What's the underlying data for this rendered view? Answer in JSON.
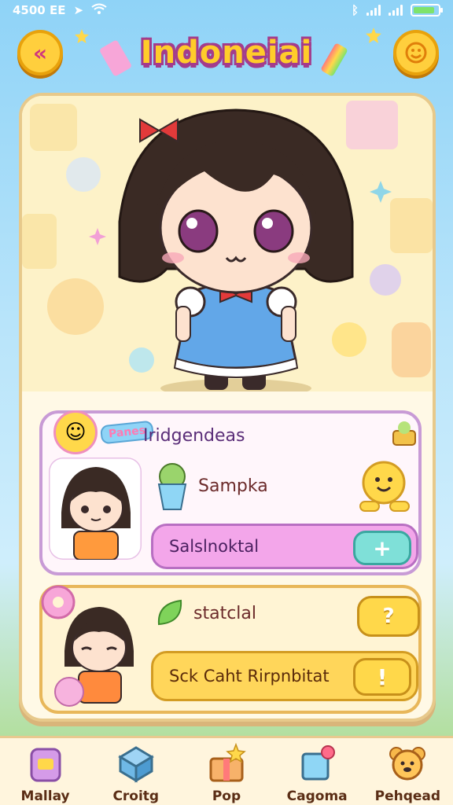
{
  "status_bar": {
    "left_text": "4500 EE",
    "battery_level": 0.85
  },
  "header": {
    "title": "Indoneiai"
  },
  "panel_pink": {
    "badge_label": "Panes",
    "heading": "Iridgendeas",
    "item_label": "Sampka",
    "action_label": "Salslnoktal",
    "action_symbol": "+"
  },
  "panel_yellow": {
    "item_label": "statclal",
    "item_symbol": "?",
    "action_label": "Sck Caht Rirpnbitat",
    "action_symbol": "!"
  },
  "bottom_nav": [
    {
      "label": "Mallay",
      "icon": "jar-icon"
    },
    {
      "label": "Croitg",
      "icon": "box-icon"
    },
    {
      "label": "Pop",
      "icon": "gift-box-icon"
    },
    {
      "label": "Cagoma",
      "icon": "cube-icon"
    },
    {
      "label": "Pehqead",
      "icon": "bear-icon"
    }
  ],
  "colors": {
    "accent_yellow": "#ffcc2a",
    "title_outline": "#a33c8c",
    "pink_panel": "#f3a6ea",
    "teal_button": "#7fe0d8"
  }
}
